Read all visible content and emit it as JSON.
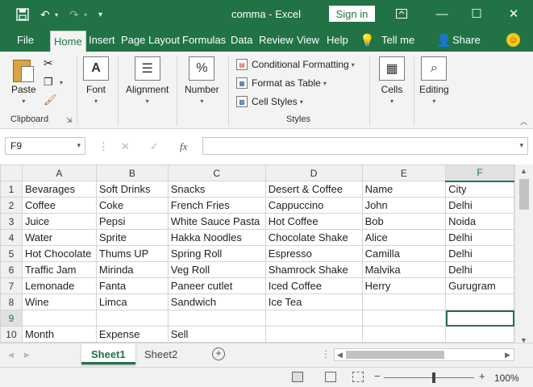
{
  "titlebar": {
    "document_title": "comma",
    "separator": "-",
    "app_name": "Excel",
    "signin_label": "Sign in",
    "accent": "#217346"
  },
  "ribbon_tabs": {
    "file": "File",
    "home": "Home",
    "insert": "Insert",
    "page_layout": "Page Layout",
    "formulas": "Formulas",
    "data": "Data",
    "review": "Review",
    "view": "View",
    "help": "Help",
    "tell_me": "Tell me",
    "share": "Share"
  },
  "ribbon": {
    "clipboard": {
      "paste": "Paste",
      "group_label": "Clipboard"
    },
    "font": {
      "label": "Font"
    },
    "alignment": {
      "label": "Alignment"
    },
    "number": {
      "label": "Number"
    },
    "styles": {
      "conditional_formatting": "Conditional Formatting",
      "format_as_table": "Format as Table",
      "cell_styles": "Cell Styles",
      "group_label": "Styles"
    },
    "cells": {
      "label": "Cells"
    },
    "editing": {
      "label": "Editing"
    }
  },
  "formula_bar": {
    "name_box": "F9",
    "fx_label": "fx",
    "formula_value": ""
  },
  "grid": {
    "columns": [
      "A",
      "B",
      "C",
      "D",
      "E",
      "F"
    ],
    "selected_column": "F",
    "selected_row": 9,
    "rows": [
      {
        "num": "1",
        "cells": [
          "Bevarages",
          "Soft Drinks",
          "Snacks",
          "Desert & Coffee",
          "Name",
          "City"
        ],
        "bold": true
      },
      {
        "num": "2",
        "cells": [
          "Coffee",
          "Coke",
          "French Fries",
          "Cappuccino",
          "John",
          "Delhi"
        ]
      },
      {
        "num": "3",
        "cells": [
          "Juice",
          "Pepsi",
          "White Sauce Pasta",
          "Hot Coffee",
          "Bob",
          "Noida"
        ]
      },
      {
        "num": "4",
        "cells": [
          "Water",
          "Sprite",
          "Hakka Noodles",
          "Chocolate Shake",
          "Alice",
          "Delhi"
        ]
      },
      {
        "num": "5",
        "cells": [
          "Hot Chocolate",
          "Thums UP",
          "Spring Roll",
          "Espresso",
          "Camilla",
          "Delhi"
        ]
      },
      {
        "num": "6",
        "cells": [
          "Traffic Jam",
          "Mirinda",
          "Veg Roll",
          "Shamrock Shake",
          "Malvika",
          "Delhi"
        ]
      },
      {
        "num": "7",
        "cells": [
          "Lemonade",
          "Fanta",
          "Paneer cutlet",
          "Iced Coffee",
          "Herry",
          "Gurugram"
        ]
      },
      {
        "num": "8",
        "cells": [
          "Wine",
          "Limca",
          "Sandwich",
          "Ice Tea",
          "",
          ""
        ]
      },
      {
        "num": "9",
        "cells": [
          "",
          "",
          "",
          "",
          "",
          ""
        ]
      },
      {
        "num": "10",
        "cells": [
          "Month",
          "Expense",
          "Sell",
          "",
          "",
          ""
        ],
        "bold": true
      }
    ]
  },
  "sheets": {
    "sheet1": "Sheet1",
    "sheet2": "Sheet2",
    "active": "Sheet1"
  },
  "statusbar": {
    "zoom_label": "100%",
    "zoom_minus": "−",
    "zoom_plus": "+"
  }
}
